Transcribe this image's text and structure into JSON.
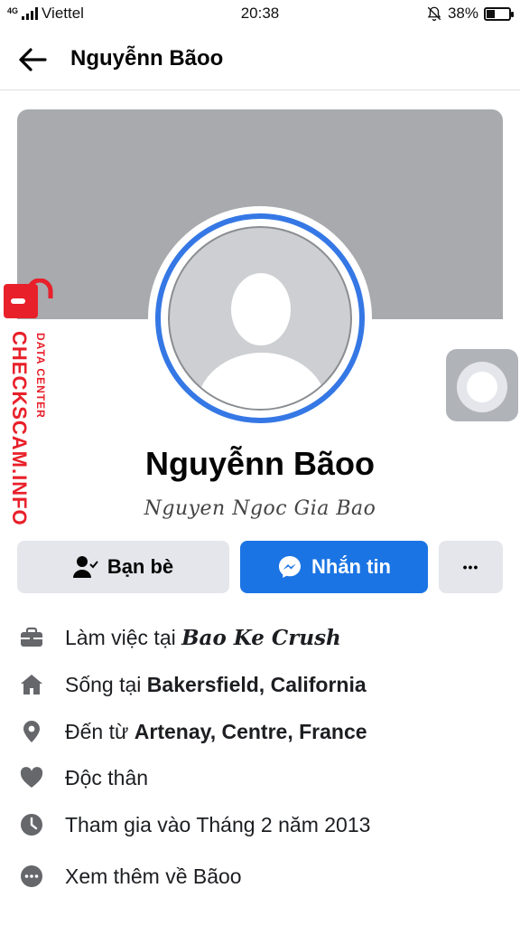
{
  "status_bar": {
    "network_label": "4G",
    "carrier": "Viettel",
    "time": "20:38",
    "battery_percent": "38%",
    "battery_level": 0.38,
    "mute_icon": "bell-off-icon"
  },
  "header": {
    "back_icon": "arrow-left-icon",
    "title": "Nguyễnn Bãoo"
  },
  "watermark": {
    "brand": "CHECKSCAM.INFO",
    "subtitle": "DATA CENTER"
  },
  "profile": {
    "name": "Nguyễnn Bãoo",
    "alt_name": "Nguyen Ngoc Gia Bao"
  },
  "actions": {
    "friends_label": "Bạn bè",
    "message_label": "Nhắn tin",
    "more_label": "•••"
  },
  "info": [
    {
      "icon": "briefcase-icon",
      "prefix": "Làm việc tại ",
      "value": "Bao Ke Crush"
    },
    {
      "icon": "home-icon",
      "prefix": "Sống tại ",
      "value": "Bakersfield, California"
    },
    {
      "icon": "location-pin-icon",
      "prefix": "Đến từ ",
      "value": "Artenay, Centre, France"
    },
    {
      "icon": "heart-icon",
      "prefix": "Độc thân",
      "value": ""
    },
    {
      "icon": "clock-icon",
      "prefix": "Tham gia vào Tháng 2 năm 2013",
      "value": ""
    },
    {
      "icon": "more-dots-icon",
      "prefix": "Xem thêm về Bãoo",
      "value": ""
    }
  ],
  "colors": {
    "accent": "#1b74e4",
    "ring": "#3578e5",
    "watermark": "#e8202a",
    "cover": "#a8aaad",
    "secondary_button": "#e4e6eb"
  }
}
